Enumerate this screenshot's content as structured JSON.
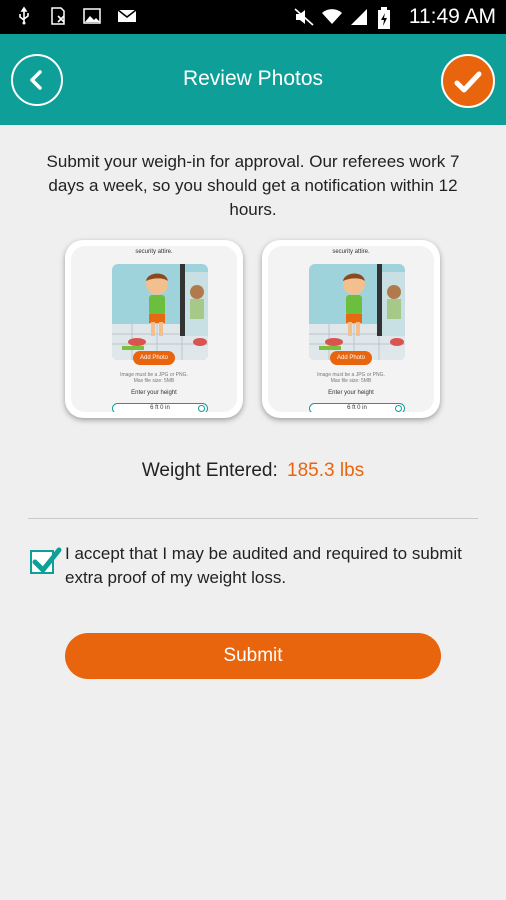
{
  "statusbar": {
    "time": "11:49 AM",
    "left_icons": [
      "usb-icon",
      "sim-icon",
      "image-icon",
      "mail-icon"
    ],
    "right_icons": [
      "mute-icon",
      "wifi-icon",
      "signal-icon",
      "battery-icon"
    ]
  },
  "header": {
    "title": "Review Photos",
    "bg_color": "#0e9f98",
    "confirm_color": "#e8650e"
  },
  "intro": "Submit your weigh-in for approval. Our referees work 7 days a week, so you should get a notification within 12 hours.",
  "photo_cards": [
    {
      "caption": "security attire.",
      "add_photo_label": "Add Photo",
      "note_line1": "Image must be a JPG or PNG.",
      "note_line2": "Max file size: 5MB",
      "height_label": "Enter your height",
      "height_value": "6 ft 0 in"
    },
    {
      "caption": "security attire.",
      "add_photo_label": "Add Photo",
      "note_line1": "Image must be a JPG or PNG.",
      "note_line2": "Max file size: 5MB",
      "height_label": "Enter your height",
      "height_value": "6 ft 0 in"
    }
  ],
  "weight": {
    "label": "Weight Entered:",
    "value": "185.3 lbs"
  },
  "accept": {
    "checked": true,
    "text": "I accept that I may be audited and required to submit extra proof of my weight loss."
  },
  "submit_label": "Submit",
  "colors": {
    "accent_orange": "#e8650e",
    "teal": "#0e9f98",
    "background": "#efefef"
  }
}
